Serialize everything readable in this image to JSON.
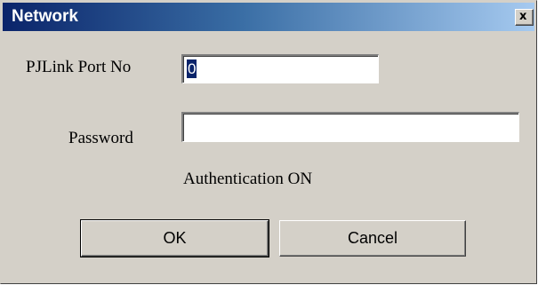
{
  "window": {
    "title": "Network",
    "close_label": "x"
  },
  "form": {
    "port_label": "PJLink Port No",
    "port_value": "0",
    "password_label": "Password",
    "password_value": "",
    "auth_status": "Authentication ON"
  },
  "buttons": {
    "ok_label": "OK",
    "cancel_label": "Cancel"
  },
  "colors": {
    "title_bar_start": "#0a246a",
    "title_bar_end": "#a6caf0",
    "dialog_face": "#d4d0c8",
    "selection": "#0a246a"
  },
  "icons": {
    "close": "close-icon"
  }
}
